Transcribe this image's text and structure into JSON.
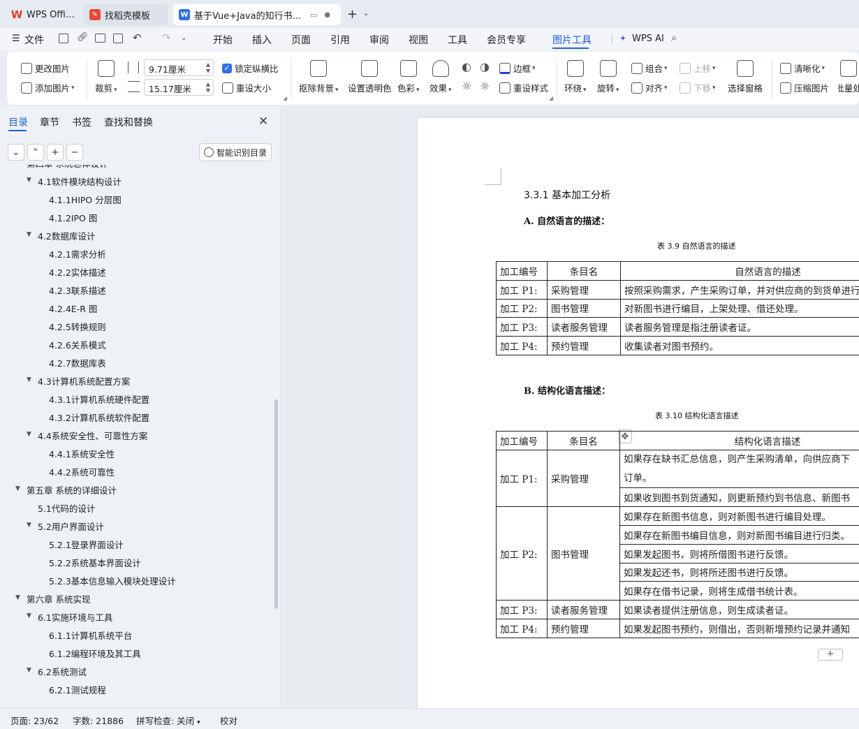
{
  "tabs": [
    {
      "label": "WPS Office"
    },
    {
      "label": "找稻壳模板"
    },
    {
      "label": "基于Vue+Java的知行书海图书"
    }
  ],
  "menus": [
    "文件",
    "开始",
    "插入",
    "页面",
    "引用",
    "审阅",
    "视图",
    "工具",
    "会员专享",
    "图片工具",
    "WPS AI"
  ],
  "active_menu": "图片工具",
  "ribbon": {
    "change_image": "更改图片",
    "add_image": "添加图片",
    "crop": "裁剪",
    "width": "9.71厘米",
    "height": "15.17厘米",
    "lock_ratio": "锁定纵横比",
    "resize": "重设大小",
    "remove_bg": "抠除背景",
    "set_transparent": "设置透明色",
    "color": "色彩",
    "effects": "效果",
    "border": "边框",
    "reset_style": "重设样式",
    "wrap": "环绕",
    "rotate": "旋转",
    "group": "组合",
    "align": "对齐",
    "move_up": "上移",
    "move_down": "下移",
    "selection_pane": "选择窗格",
    "sharpen": "清晰化",
    "compress": "压缩图片",
    "batch": "批量处"
  },
  "nav": {
    "tabs": [
      "目录",
      "章节",
      "书签",
      "查找和替换"
    ],
    "smart_toc": "智能识别目录",
    "toc": [
      {
        "text": "第四章 系统总体设计",
        "level": 0,
        "caret": true
      },
      {
        "text": "4.1软件模块结构设计",
        "level": 1,
        "caret": true
      },
      {
        "text": "4.1.1HIPO 分层图",
        "level": 2,
        "caret": false
      },
      {
        "text": "4.1.2IPO 图",
        "level": 2,
        "caret": false
      },
      {
        "text": "4.2数据库设计",
        "level": 1,
        "caret": true
      },
      {
        "text": "4.2.1需求分析",
        "level": 2,
        "caret": false
      },
      {
        "text": "4.2.2实体描述",
        "level": 2,
        "caret": false
      },
      {
        "text": "4.2.3联系描述",
        "level": 2,
        "caret": false
      },
      {
        "text": "4.2.4E-R 图",
        "level": 2,
        "caret": false
      },
      {
        "text": "4.2.5转换规则",
        "level": 2,
        "caret": false
      },
      {
        "text": "4.2.6关系模式",
        "level": 2,
        "caret": false
      },
      {
        "text": "4.2.7数据库表",
        "level": 2,
        "caret": false
      },
      {
        "text": "4.3计算机系统配置方案",
        "level": 1,
        "caret": true
      },
      {
        "text": "4.3.1计算机系统硬件配置",
        "level": 2,
        "caret": false
      },
      {
        "text": "4.3.2计算机系统软件配置",
        "level": 2,
        "caret": false
      },
      {
        "text": "4.4系统安全性、可靠性方案",
        "level": 1,
        "caret": true
      },
      {
        "text": "4.4.1系统安全性",
        "level": 2,
        "caret": false
      },
      {
        "text": "4.4.2系统可靠性",
        "level": 2,
        "caret": false
      },
      {
        "text": "第五章  系统的详细设计",
        "level": 0,
        "caret": true
      },
      {
        "text": "5.1代码的设计",
        "level": 1,
        "caret": false
      },
      {
        "text": "5.2用户界面设计",
        "level": 1,
        "caret": true
      },
      {
        "text": "5.2.1登录界面设计",
        "level": 2,
        "caret": false
      },
      {
        "text": "5.2.2系统基本界面设计",
        "level": 2,
        "caret": false
      },
      {
        "text": "5.2.3基本信息输入模块处理设计",
        "level": 2,
        "caret": false
      },
      {
        "text": "第六章  系统实现",
        "level": 0,
        "caret": true
      },
      {
        "text": "6.1实施环境与工具",
        "level": 1,
        "caret": true
      },
      {
        "text": "6.1.1计算机系统平台",
        "level": 2,
        "caret": false
      },
      {
        "text": "6.1.2编程环境及其工具",
        "level": 2,
        "caret": false
      },
      {
        "text": "6.2系统测试",
        "level": 1,
        "caret": true
      },
      {
        "text": "6.2.1测试规程",
        "level": 2,
        "caret": false
      }
    ]
  },
  "doc": {
    "section_title": "3.3.1  基本加工分析",
    "sub_a": "A.  自然语言的描述：",
    "caption1": "表 3.9  自然语言的描述",
    "table1": {
      "headers": [
        "加工编号",
        "条目名",
        "自然语言的描述"
      ],
      "rows": [
        [
          "加工 P1:",
          "采购管理",
          "按照采购需求，产生采购订单，并对供应商的到货单进行"
        ],
        [
          "加工 P2:",
          "图书管理",
          "对新图书进行编目，上架处理、借还处理。"
        ],
        [
          "加工 P3:",
          "读者服务管理",
          "读者服务管理是指注册读者证。"
        ],
        [
          "加工 P4:",
          "预约管理",
          "收集读者对图书预约。"
        ]
      ]
    },
    "sub_b": "B.  结构化语言描述：",
    "caption2": "表 3.10  结构化语言描述",
    "table2": {
      "headers": [
        "加工编号",
        "条目名",
        "结构化语言描述"
      ],
      "p1_id": "加工 P1:",
      "p1_name": "采购管理",
      "p1_desc": [
        "如果存在缺书汇总信息，则产生采购清单，向供应商下",
        "订单。",
        "如果收到图书到货通知，则更新预约到书信息、新图书"
      ],
      "p2_id": "加工 P2:",
      "p2_name": "图书管理",
      "p2_desc": [
        "如果存在新图书信息，则对新图书进行编目处理。",
        "如果存在新图书编目信息，则对新图书编目进行归类。",
        "如果发起图书，则将所借图书进行反馈。",
        "如果发起还书，则将所还图书进行反馈。",
        "如果存在借书记录，则将生成借书统计表。"
      ],
      "p3_id": "加工 P3:",
      "p3_name": "读者服务管理",
      "p3_desc": "如果读者提供注册信息，则生成读者证。",
      "p4_id": "加工 P4:",
      "p4_name": "预约管理",
      "p4_desc": "如果发起图书预约，则借出，否则新增预约记录并通知"
    }
  },
  "status": {
    "page": "页面: 23/62",
    "words": "字数: 21886",
    "spell": "拼写检查: 关闭",
    "proof": "校对"
  }
}
